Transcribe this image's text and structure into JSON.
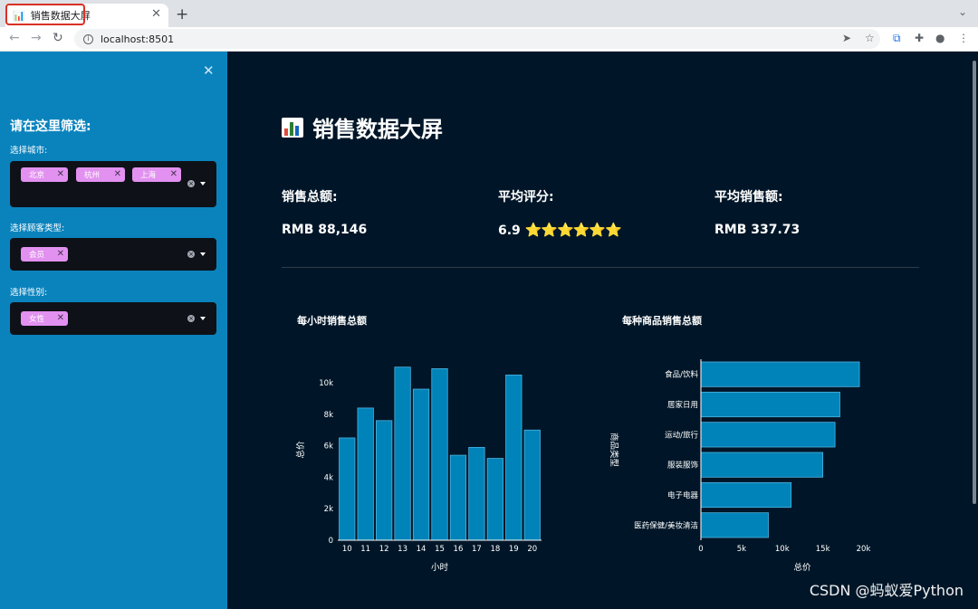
{
  "browser": {
    "tab_title": "销售数据大屏",
    "tab_favicon": "bar-chart-icon",
    "url": "localhost:8501"
  },
  "sidebar": {
    "title": "请在这里筛选:",
    "filters": [
      {
        "label": "选择城市:",
        "chips": [
          "北京",
          "杭州",
          "上海"
        ]
      },
      {
        "label": "选择顾客类型:",
        "chips": [
          "会员"
        ]
      },
      {
        "label": "选择性别:",
        "chips": [
          "女性"
        ]
      }
    ]
  },
  "main": {
    "title": "销售数据大屏",
    "kpis": [
      {
        "label": "销售总额:",
        "value": "RMB 88,146"
      },
      {
        "label": "平均评分:",
        "value": "6.9",
        "stars": "⭐⭐⭐⭐⭐⭐"
      },
      {
        "label": "平均销售额:",
        "value": "RMB 337.73"
      }
    ]
  },
  "watermark": "CSDN @蚂蚁爱Python",
  "colors": {
    "sidebar_bg": "#0a83bd",
    "main_bg": "#001628",
    "bar": "#0083b8",
    "chip": "#e291f0"
  },
  "chart_data": [
    {
      "type": "bar",
      "title": "每小时销售总额",
      "xlabel": "小时",
      "ylabel": "总价",
      "categories": [
        "10",
        "11",
        "12",
        "13",
        "14",
        "15",
        "16",
        "17",
        "18",
        "19",
        "20"
      ],
      "values": [
        6500,
        8400,
        7600,
        11000,
        9600,
        10900,
        5400,
        5900,
        5200,
        10500,
        7000
      ],
      "ylim": [
        0,
        11500
      ],
      "yticks": [
        0,
        2000,
        4000,
        6000,
        8000,
        10000
      ],
      "ytick_labels": [
        "0",
        "2k",
        "4k",
        "6k",
        "8k",
        "10k"
      ],
      "grid": false
    },
    {
      "type": "bar",
      "orientation": "horizontal",
      "title": "每种商品销售总额",
      "xlabel": "总价",
      "ylabel": "商品类型",
      "categories": [
        "食品/饮料",
        "居家日用",
        "运动/旅行",
        "服装服饰",
        "电子电器",
        "医药保健/美妆清洁"
      ],
      "values": [
        19500,
        17100,
        16500,
        15000,
        11100,
        8300
      ],
      "xlim": [
        0,
        20500
      ],
      "xticks": [
        0,
        5000,
        10000,
        15000,
        20000
      ],
      "xtick_labels": [
        "0",
        "5k",
        "10k",
        "15k",
        "20k"
      ],
      "grid": false
    }
  ]
}
